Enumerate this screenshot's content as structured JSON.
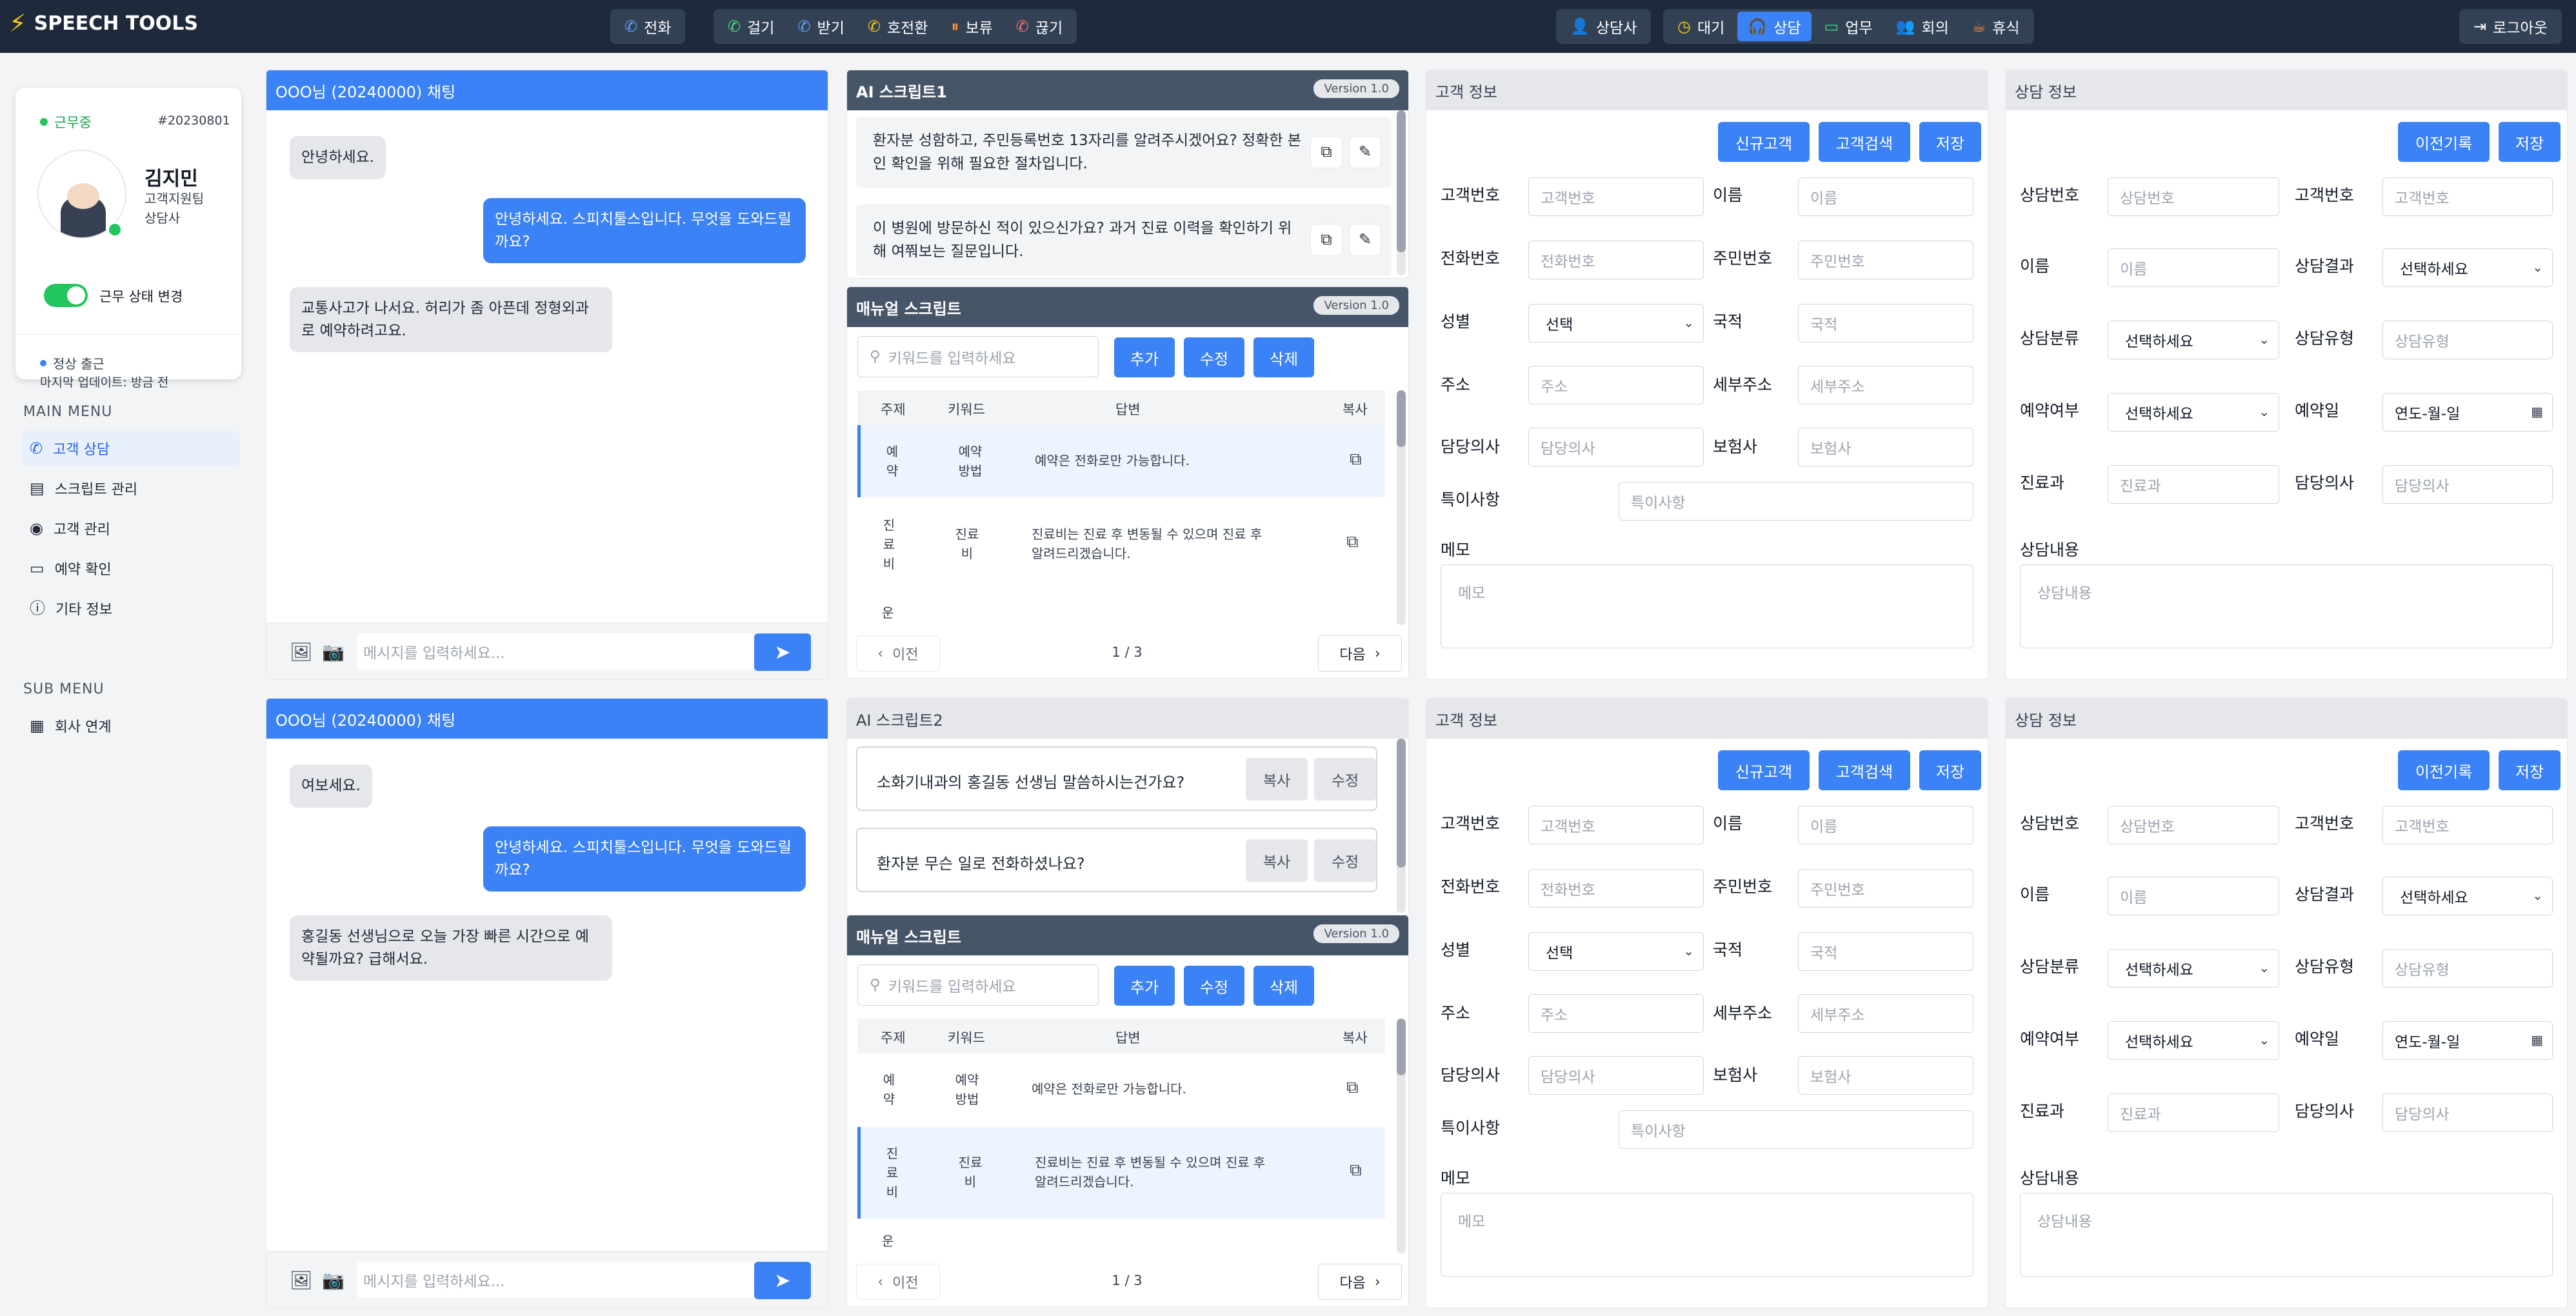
{
  "app": {
    "logo_text": "SPEECH TOOLS"
  },
  "topbar": {
    "call_group1": {
      "call_label": "전화"
    },
    "call_group2": {
      "dial_label": "걸기",
      "receive_label": "받기",
      "transfer_label": "호전환",
      "hold_label": "보류",
      "hangup_label": "끊기"
    },
    "agent_label": "상담사",
    "status_group": {
      "wait_label": "대기",
      "consult_label": "상담",
      "work_label": "업무",
      "meeting_label": "회의",
      "rest_label": "휴식"
    },
    "logout_label": "로그아웃"
  },
  "profile": {
    "status_text": "근무중",
    "employee_id": "#20230801",
    "name": "김지민",
    "team": "고객지원팀",
    "role": "상담사",
    "toggle_label": "근무 상태 변경",
    "attendance_text": "정상 출근",
    "last_update_text": "마지막 업데이트: 방금 전"
  },
  "sidebar": {
    "main_menu_title": "MAIN MENU",
    "main_items": [
      {
        "label": "고객 상담",
        "icon": "phone-icon"
      },
      {
        "label": "스크립트 관리",
        "icon": "script-icon"
      },
      {
        "label": "고객 관리",
        "icon": "user-circle-icon"
      },
      {
        "label": "예약 확인",
        "icon": "monitor-icon"
      },
      {
        "label": "기타 정보",
        "icon": "info-icon"
      }
    ],
    "sub_menu_title": "SUB MENU",
    "sub_items": [
      {
        "label": "회사 연계",
        "icon": "building-icon"
      }
    ]
  },
  "chat1": {
    "title": "OOO님 (20240000) 채팅",
    "messages": [
      {
        "dir": "in",
        "text": "안녕하세요."
      },
      {
        "dir": "out",
        "text": "안녕하세요. 스피치툴스입니다. 무엇을 도와드릴까요?"
      },
      {
        "dir": "in",
        "text": "교통사고가 나서요. 허리가 좀 아픈데 정형외과로 예약하려고요."
      }
    ],
    "input_placeholder": "메시지를 입력하세요..."
  },
  "chat2": {
    "title": "OOO님 (20240000) 채팅",
    "messages": [
      {
        "dir": "in",
        "text": "여보세요."
      },
      {
        "dir": "out",
        "text": "안녕하세요. 스피치툴스입니다. 무엇을 도와드릴까요?"
      },
      {
        "dir": "in",
        "text": "홍길동 선생님으로 오늘 가장 빠른 시간으로 예약될까요? 급해서요."
      }
    ],
    "input_placeholder": "메시지를 입력하세요..."
  },
  "ai1": {
    "title": "AI 스크립트1",
    "version": "Version 1.0",
    "cards": [
      "환자분 성함하고, 주민등록번호 13자리를 알려주시겠어요? 정확한 본인 확인을 위해 필요한 절차입니다.",
      "이 병원에 방문하신 적이 있으신가요? 과거 진료 이력을 확인하기 위해 여쭤보는 질문입니다."
    ]
  },
  "ai2": {
    "title": "AI 스크립트2",
    "cards": [
      "소화기내과의 홍길동 선생님 말씀하시는건가요?",
      "환자분 무슨 일로 전화하셨나요?"
    ],
    "copy_label": "복사",
    "edit_label": "수정"
  },
  "manual": {
    "title": "매뉴얼 스크립트",
    "version": "Version 1.0",
    "search_placeholder": "키워드를 입력하세요",
    "add_label": "추가",
    "edit_label": "수정",
    "delete_label": "삭제",
    "columns": [
      "주제",
      "키워드",
      "답변",
      "복사"
    ],
    "rows": [
      {
        "topic": "예\n약",
        "keyword": "예약\n방법",
        "answer": "예약은 전화로만 가능합니다."
      },
      {
        "topic": "진\n료\n비",
        "keyword": "진료\n비",
        "answer": "진료비는 진료 후 변동될 수 있으며 진료 후\n알려드리겠습니다."
      },
      {
        "topic": "운",
        "keyword": "",
        "answer": ""
      }
    ],
    "prev_label": "이전",
    "next_label": "다음",
    "page_text": "1 / 3"
  },
  "customer": {
    "title": "고객 정보",
    "new_label": "신규고객",
    "search_label": "고객검색",
    "save_label": "저장",
    "fields": {
      "customer_no": {
        "label": "고객번호",
        "placeholder": "고객번호"
      },
      "name": {
        "label": "이름",
        "placeholder": "이름"
      },
      "phone": {
        "label": "전화번호",
        "placeholder": "전화번호"
      },
      "resident_no": {
        "label": "주민번호",
        "placeholder": "주민번호"
      },
      "gender": {
        "label": "성별",
        "value": "선택"
      },
      "nationality": {
        "label": "국적",
        "placeholder": "국적"
      },
      "address": {
        "label": "주소",
        "placeholder": "주소"
      },
      "address_detail": {
        "label": "세부주소",
        "placeholder": "세부주소"
      },
      "doctor": {
        "label": "담당의사",
        "placeholder": "담당의사"
      },
      "insurer": {
        "label": "보험사",
        "placeholder": "보험사"
      },
      "notes": {
        "label": "특이사항",
        "placeholder": "특이사항"
      },
      "memo": {
        "label": "메모",
        "placeholder": "메모"
      }
    }
  },
  "consult": {
    "title": "상담 정보",
    "history_label": "이전기록",
    "save_label": "저장",
    "fields": {
      "consult_no": {
        "label": "상담번호",
        "placeholder": "상담번호"
      },
      "customer_no": {
        "label": "고객번호",
        "placeholder": "고객번호"
      },
      "name": {
        "label": "이름",
        "placeholder": "이름"
      },
      "result": {
        "label": "상담결과",
        "value": "선택하세요"
      },
      "category": {
        "label": "상담분류",
        "value": "선택하세요"
      },
      "type": {
        "label": "상담유형",
        "placeholder": "상담유형"
      },
      "reservation": {
        "label": "예약여부",
        "value": "선택하세요"
      },
      "date": {
        "label": "예약일",
        "value": "연도-월-일"
      },
      "department": {
        "label": "진료과",
        "placeholder": "진료과"
      },
      "doctor": {
        "label": "담당의사",
        "placeholder": "담당의사"
      },
      "content": {
        "label": "상담내용",
        "placeholder": "상담내용"
      }
    }
  }
}
